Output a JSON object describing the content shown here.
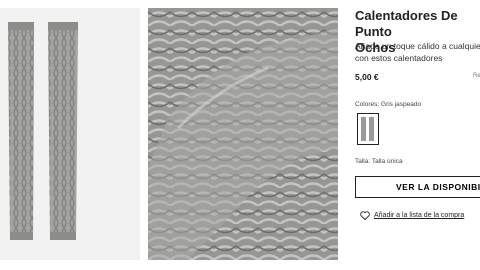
{
  "product": {
    "title": "Calentadores De Punto\nOchos",
    "description": "Añade un toque cálido a cualquie con estos calentadores",
    "price": "5,00 €",
    "reference": "Re",
    "colors_label": "Colores: Gris jaspeado",
    "size_label": "Talla: Talla única",
    "availability_button": "VER LA DISPONIBILIDA",
    "wishlist_link": "Añadir a la lista de la compra"
  },
  "colors": {
    "knit_gray": "#9a9a98",
    "accent": "#222222"
  },
  "icons": {
    "wishlist": "heart-outline-icon"
  }
}
